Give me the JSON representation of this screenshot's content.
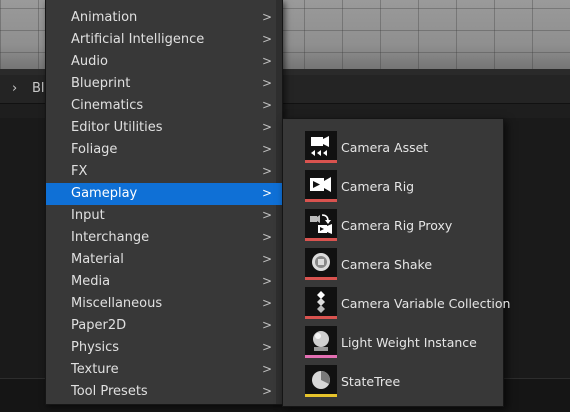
{
  "background": {
    "breadcrumb": "Bl"
  },
  "colors": {
    "menu_bg": "#383838",
    "highlight": "#0f70d6",
    "camera_bar": "#d9534f",
    "pink_bar": "#e36fb2",
    "yellow_bar": "#e6c32b"
  },
  "menu": {
    "items": [
      {
        "label": "Animation"
      },
      {
        "label": "Artificial Intelligence"
      },
      {
        "label": "Audio"
      },
      {
        "label": "Blueprint"
      },
      {
        "label": "Cinematics"
      },
      {
        "label": "Editor Utilities"
      },
      {
        "label": "Foliage"
      },
      {
        "label": "FX"
      },
      {
        "label": "Gameplay",
        "active": true
      },
      {
        "label": "Input"
      },
      {
        "label": "Interchange"
      },
      {
        "label": "Material"
      },
      {
        "label": "Media"
      },
      {
        "label": "Miscellaneous"
      },
      {
        "label": "Paper2D"
      },
      {
        "label": "Physics"
      },
      {
        "label": "Texture"
      },
      {
        "label": "Tool Presets"
      }
    ]
  },
  "submenu": {
    "items": [
      {
        "label": "Camera Asset",
        "icon": "camera-asset-icon"
      },
      {
        "label": "Camera Rig",
        "icon": "camera-rig-icon"
      },
      {
        "label": "Camera Rig Proxy",
        "icon": "camera-rig-proxy-icon"
      },
      {
        "label": "Camera Shake",
        "icon": "camera-shake-icon"
      },
      {
        "label": "Camera Variable Collection",
        "icon": "camera-variable-collection-icon"
      },
      {
        "label": "Light Weight Instance",
        "icon": "light-weight-instance-icon"
      },
      {
        "label": "StateTree",
        "icon": "state-tree-icon"
      }
    ]
  }
}
